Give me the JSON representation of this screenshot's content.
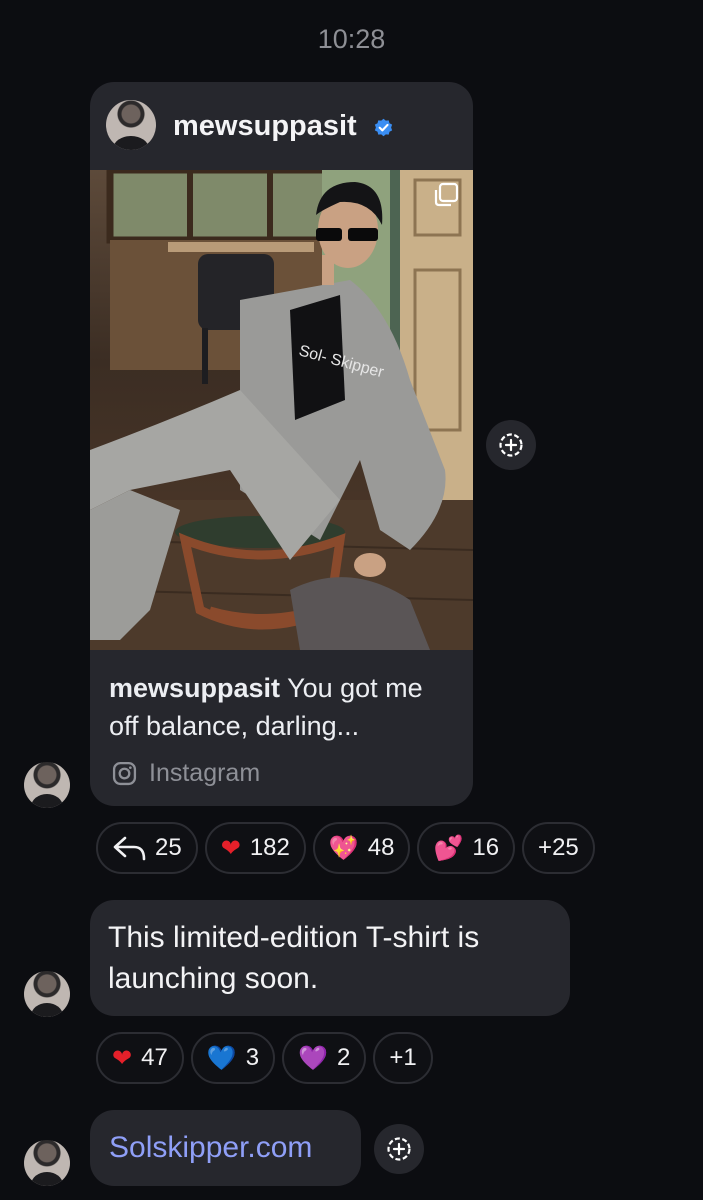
{
  "timestamp": "10:28",
  "shared_post": {
    "author": "mewsuppasit",
    "caption_text": "You got me off balance, darling...",
    "source": "Instagram",
    "shirt_text": "Sol- Skipper"
  },
  "reactions_1": [
    {
      "icon": "reply-icon",
      "count": "25"
    },
    {
      "icon": "red-heart",
      "emoji": "❤",
      "count": "182"
    },
    {
      "icon": "sparkling-heart",
      "emoji": "💖",
      "count": "48"
    },
    {
      "icon": "two-hearts",
      "emoji": "💕",
      "count": "16"
    },
    {
      "count": "+25"
    }
  ],
  "message_1": {
    "text": "This limited-edition T-shirt is launching soon."
  },
  "reactions_2": [
    {
      "icon": "red-heart",
      "emoji": "❤",
      "count": "47"
    },
    {
      "icon": "blue-heart",
      "emoji": "💙",
      "count": "3"
    },
    {
      "icon": "purple-heart",
      "emoji": "💜",
      "count": "2"
    },
    {
      "count": "+1"
    }
  ],
  "message_2": {
    "link": "Solskipper.com"
  },
  "colors": {
    "background": "#0c0d11",
    "bubble": "#26272d",
    "link": "#8f9ff7",
    "verified": "#3a8ef3"
  }
}
